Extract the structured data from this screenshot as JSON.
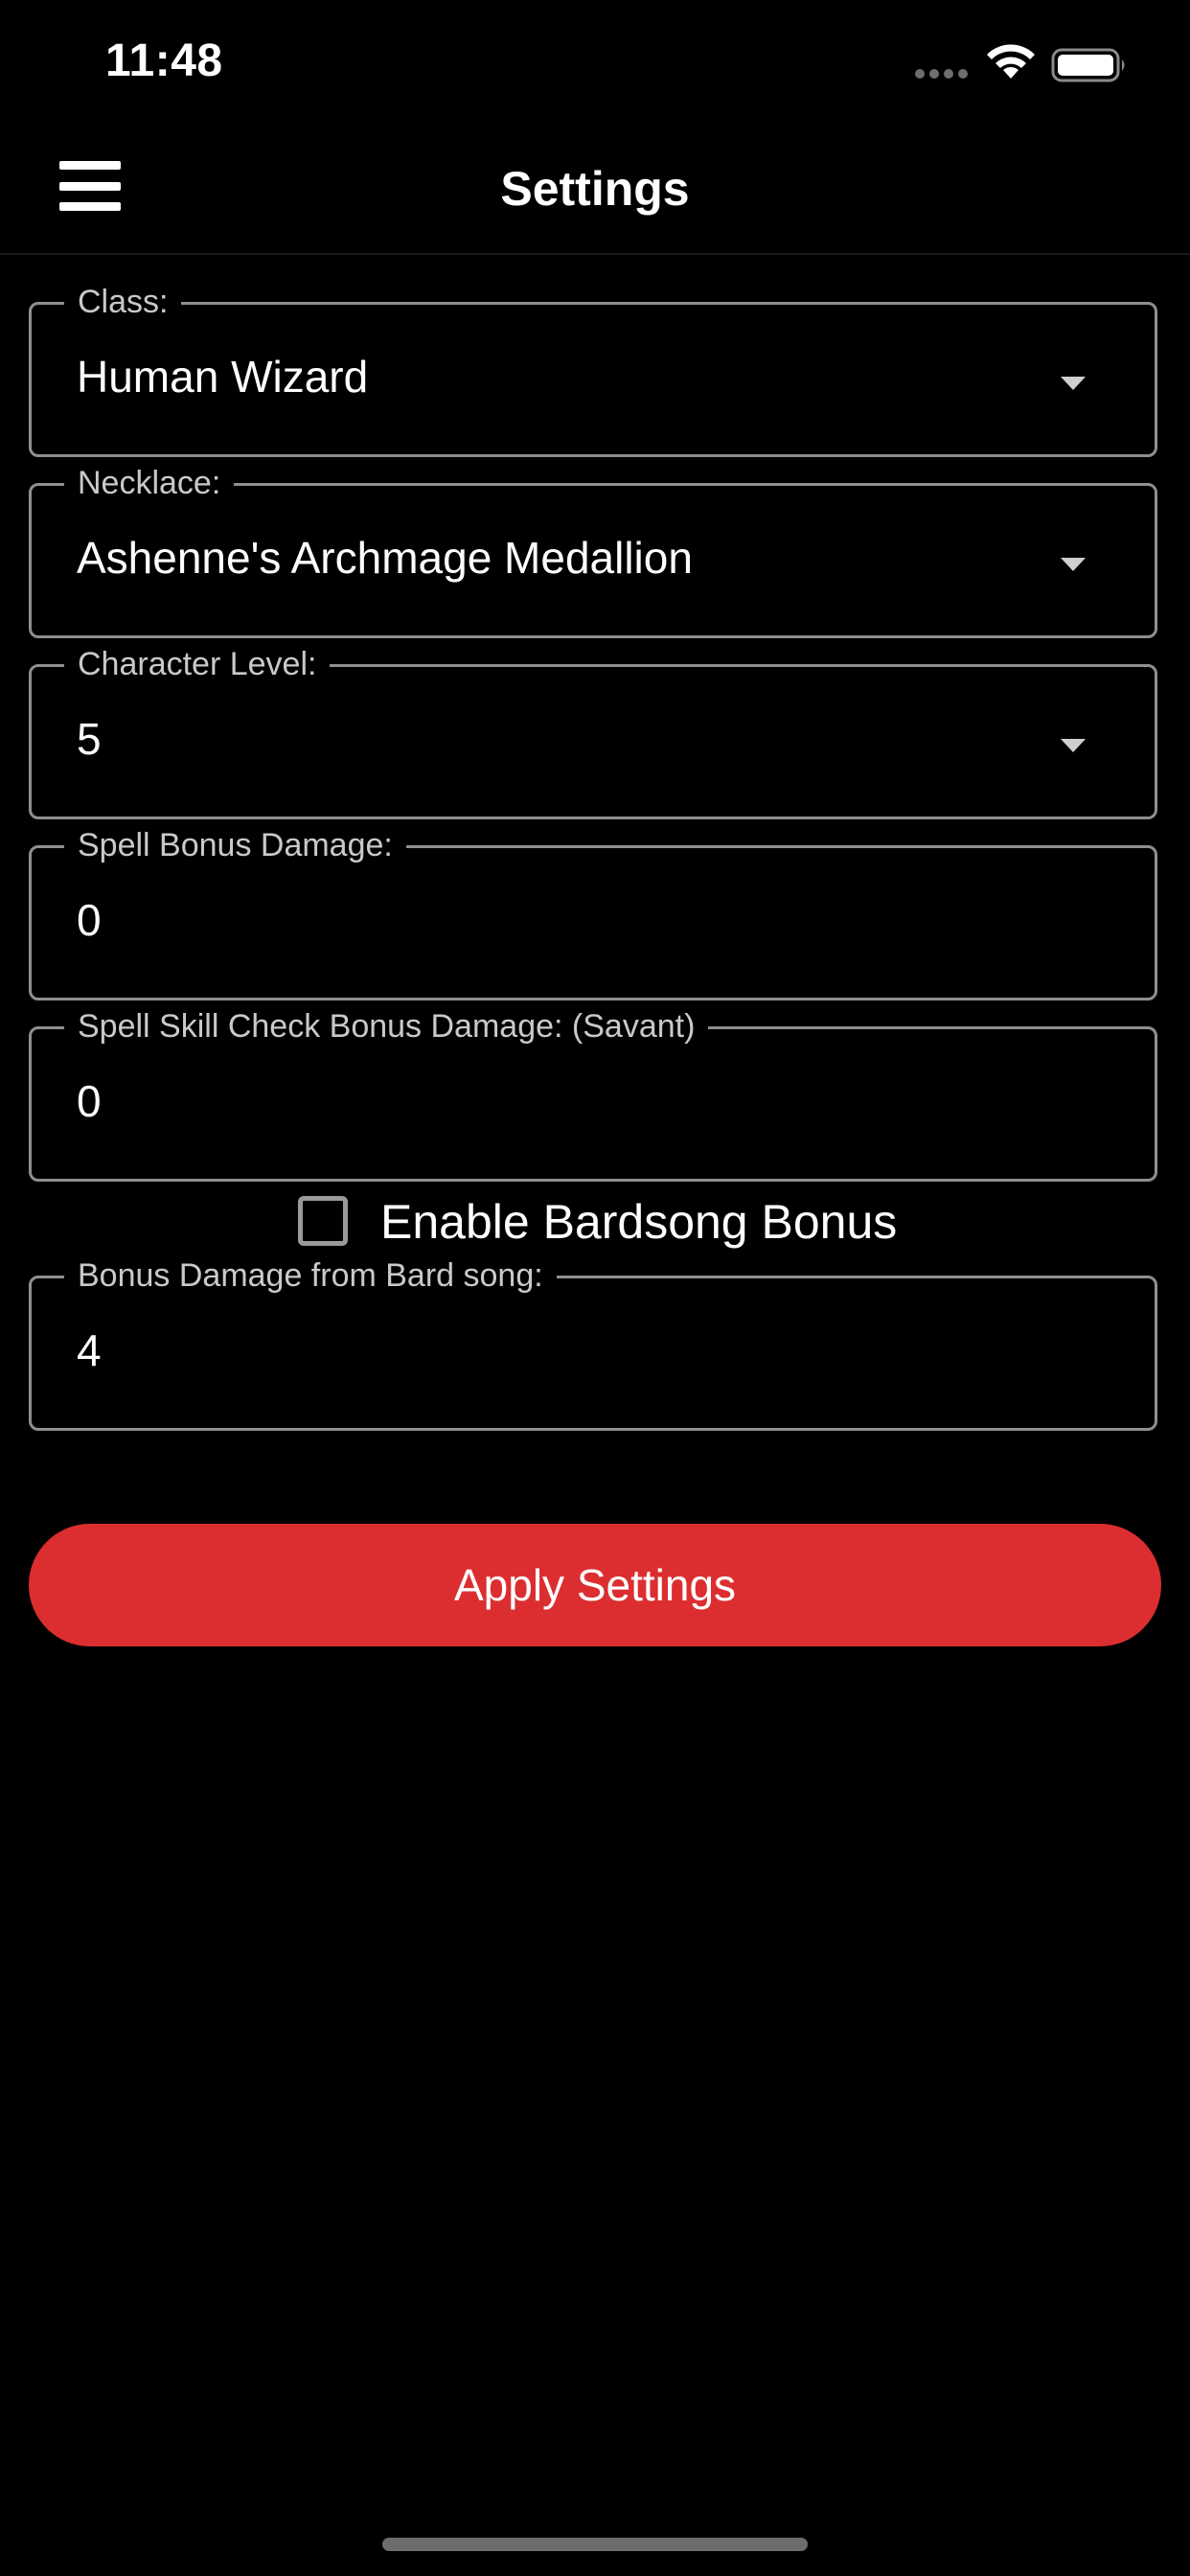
{
  "status_bar": {
    "time": "11:48"
  },
  "app_bar": {
    "title": "Settings",
    "menu_icon": "hamburger-menu-icon"
  },
  "fields": {
    "class": {
      "label": "Class:",
      "value": "Human Wizard"
    },
    "necklace": {
      "label": "Necklace:",
      "value": "Ashenne's Archmage Medallion"
    },
    "character_level": {
      "label": "Character Level:",
      "value": "5"
    },
    "spell_bonus_damage": {
      "label": "Spell Bonus Damage:",
      "value": "0"
    },
    "spell_skill_check_bonus": {
      "label": "Spell Skill Check Bonus Damage: (Savant)",
      "value": "0"
    },
    "bard_song_bonus": {
      "label": "Bonus Damage from Bard song:",
      "value": "4"
    }
  },
  "bardsong_toggle": {
    "label": "Enable Bardsong Bonus",
    "checked": false
  },
  "apply_button": {
    "label": "Apply Settings",
    "color": "#dc2e30"
  },
  "colors": {
    "background": "#000000",
    "field_border": "#8f8f8f",
    "label_text": "#c9c9c9",
    "accent": "#dc2e30"
  }
}
